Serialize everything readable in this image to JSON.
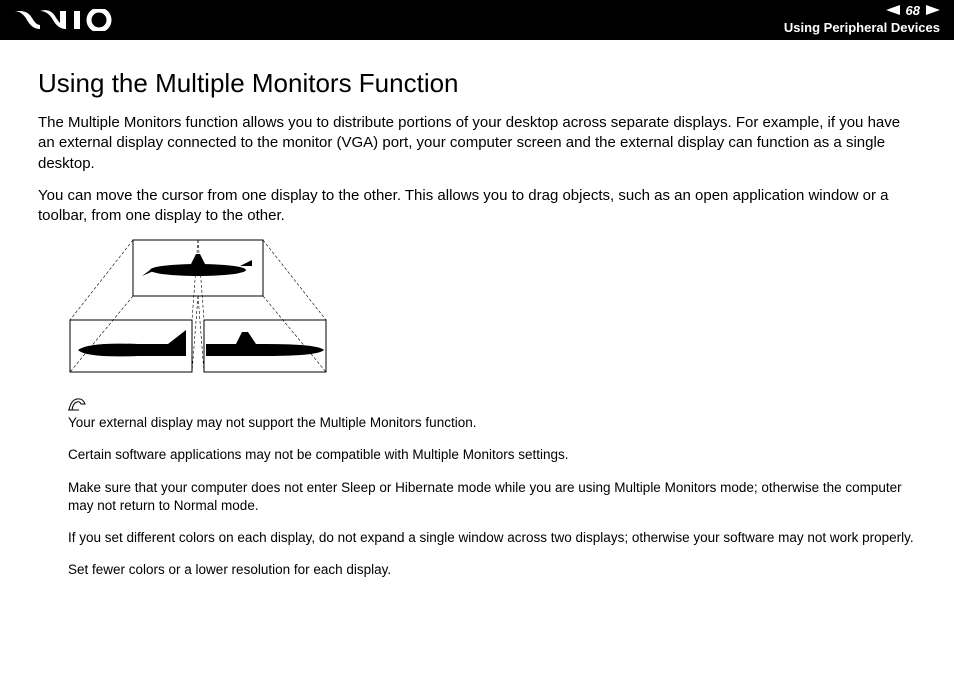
{
  "header": {
    "page_number": "68",
    "section_label": "Using Peripheral Devices"
  },
  "title": "Using the Multiple Monitors Function",
  "paragraphs": {
    "p1": "The Multiple Monitors function allows you to distribute portions of your desktop across separate displays. For example, if you have an external display connected to the monitor (VGA) port, your computer screen and the external display can function as a single desktop.",
    "p2": "You can move the cursor from one display to the other. This allows you to drag objects, such as an open application window or a toolbar, from one display to the other."
  },
  "notes": {
    "n1": "Your external display may not support the Multiple Monitors function.",
    "n2": "Certain software applications may not be compatible with Multiple Monitors settings.",
    "n3": "Make sure that your computer does not enter Sleep or Hibernate mode while you are using Multiple Monitors mode; otherwise the computer may not return to Normal mode.",
    "n4": "If you set different colors on each display, do not expand a single window across two displays; otherwise your software may not work properly.",
    "n5": "Set fewer colors or a lower resolution for each display."
  }
}
